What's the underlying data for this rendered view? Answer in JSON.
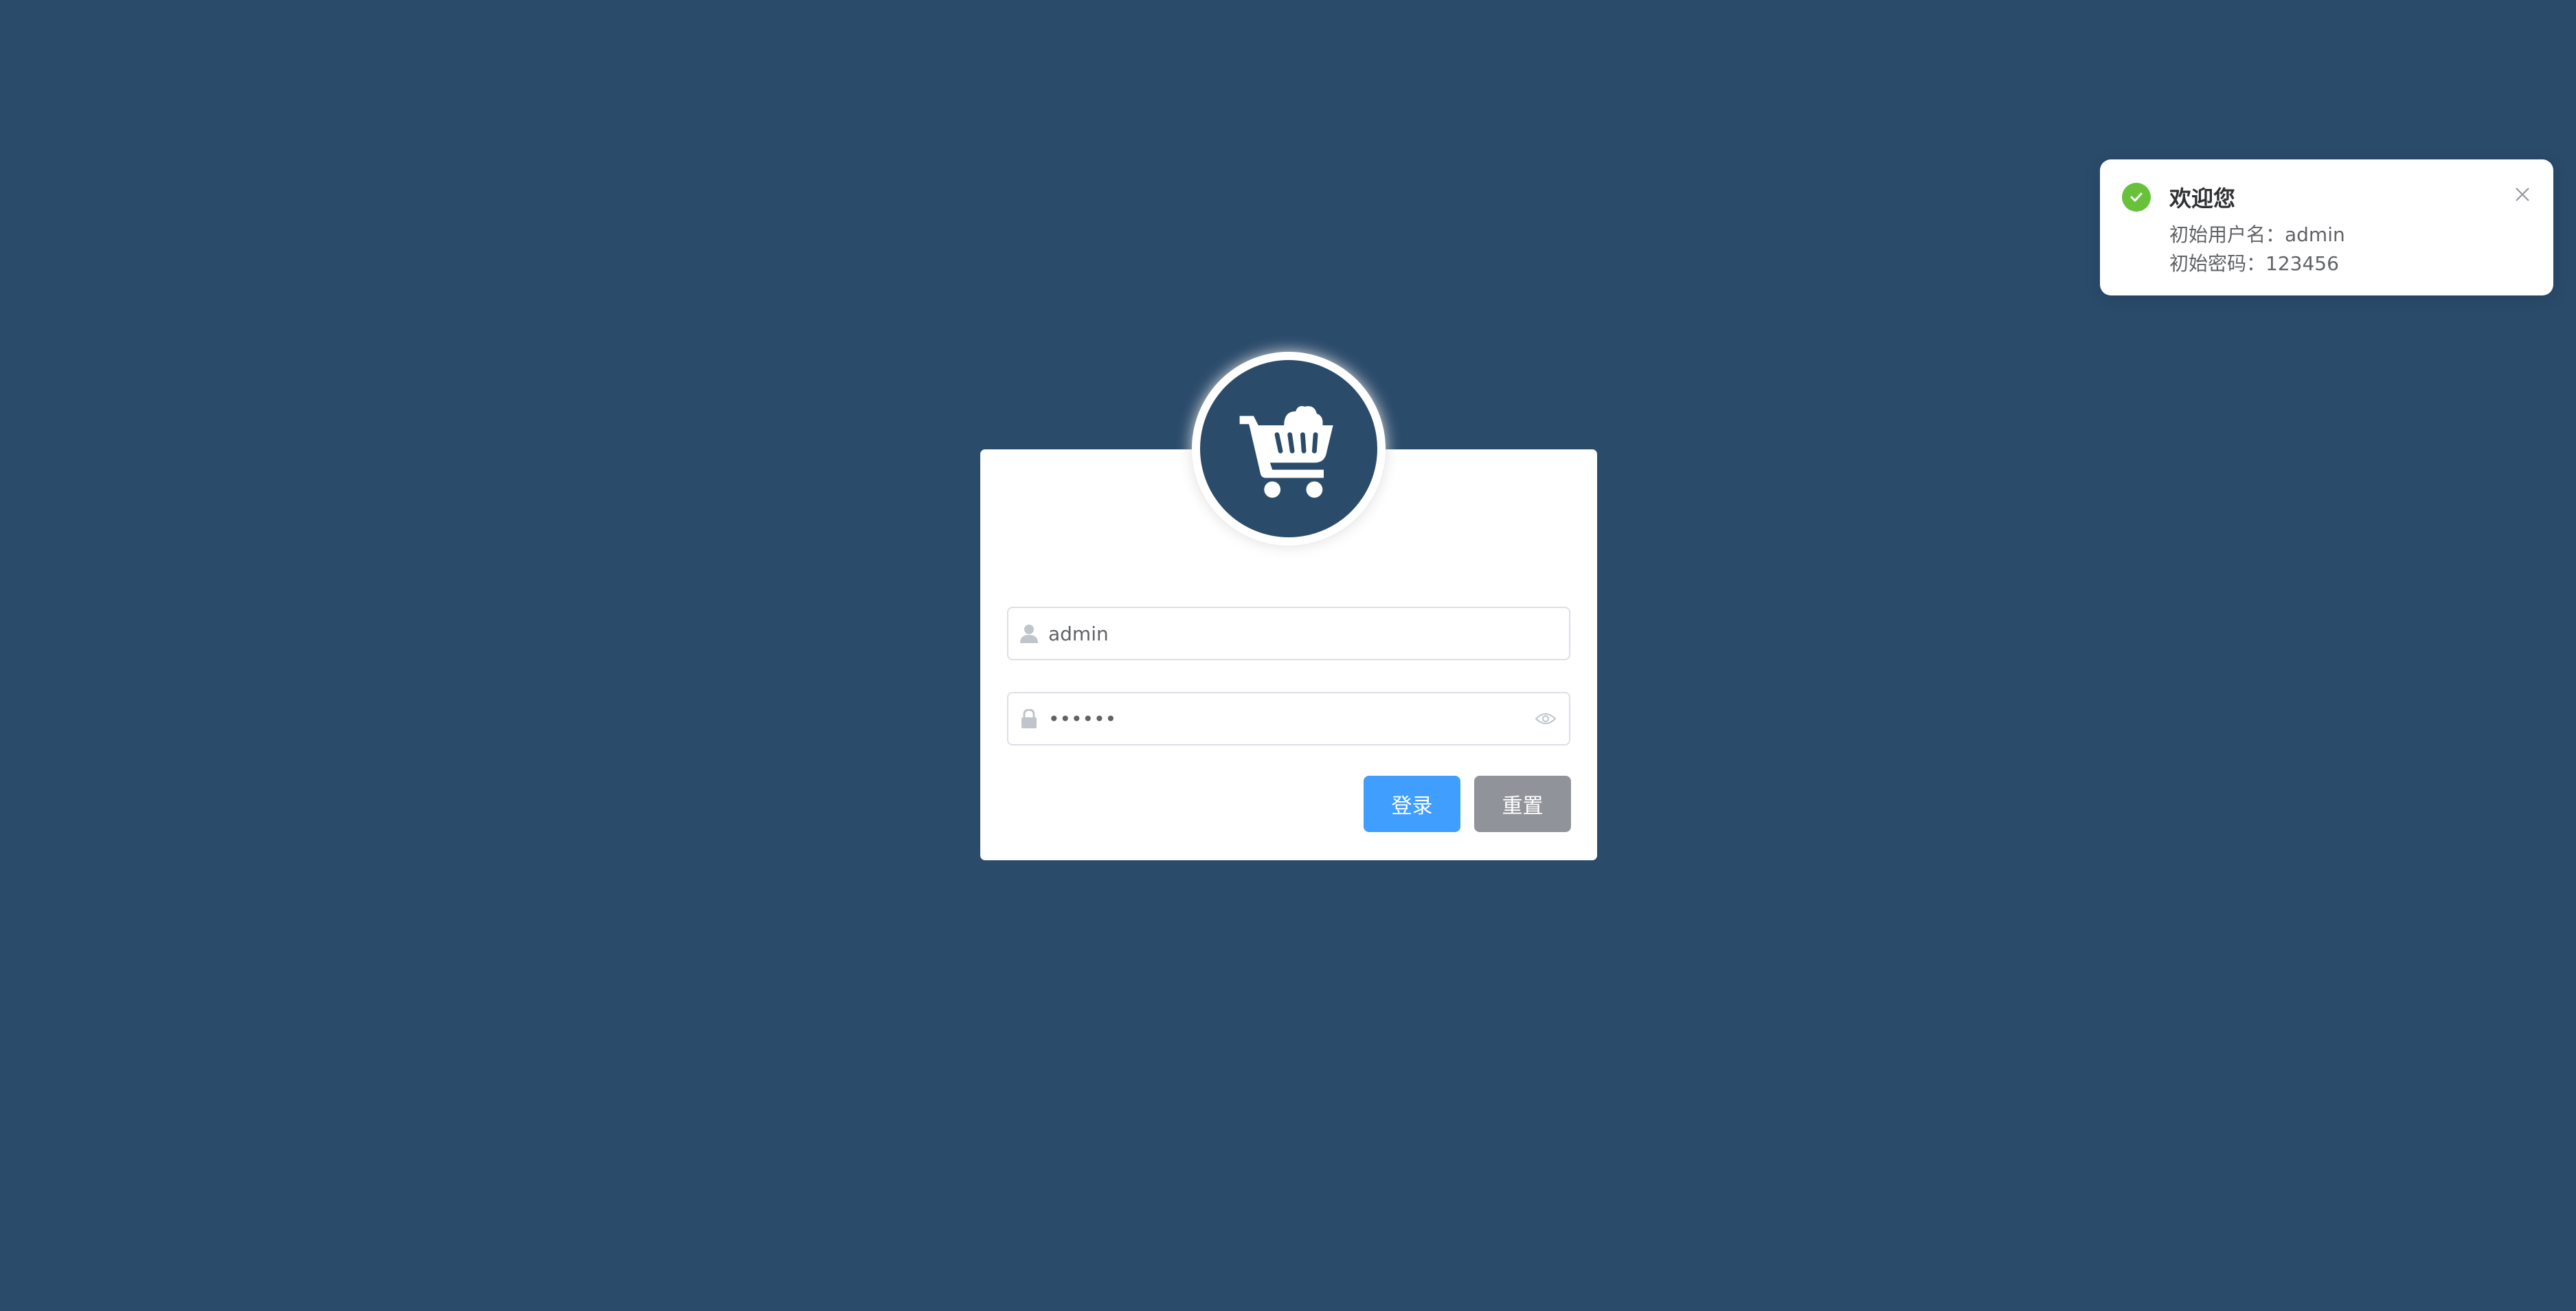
{
  "colors": {
    "background": "#2b4b6b",
    "primary": "#409eff",
    "info": "#909399",
    "success": "#67c23a"
  },
  "login": {
    "logo_icon": "shopping-cart-icon",
    "username": {
      "icon": "user-icon",
      "value": "admin"
    },
    "password": {
      "icon": "lock-icon",
      "value": "123456",
      "toggle_icon": "eye-icon"
    },
    "buttons": {
      "login_label": "登录",
      "reset_label": "重置"
    }
  },
  "notification": {
    "type": "success",
    "icon": "check-circle-icon",
    "title": "欢迎您",
    "lines": [
      "初始用户名：admin",
      "初始密码：123456"
    ],
    "close_icon": "close-icon"
  }
}
